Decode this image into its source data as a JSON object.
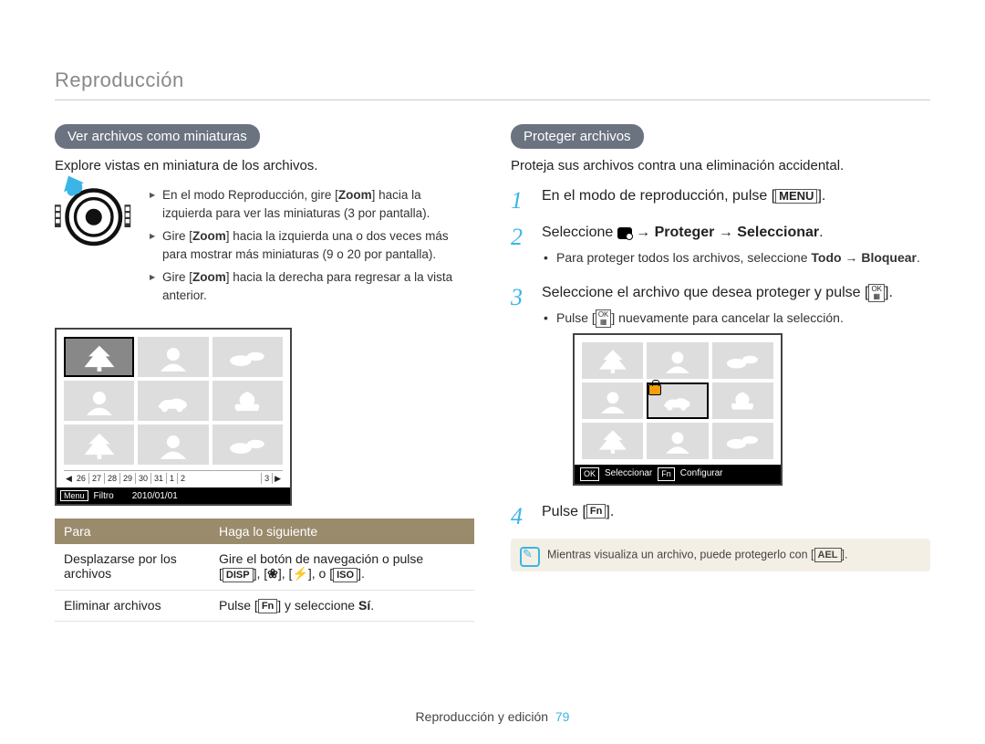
{
  "header": {
    "title": "Reproducción"
  },
  "left": {
    "pill": "Ver archivos como miniaturas",
    "intro": "Explore vistas en miniatura de los archivos.",
    "zoom_b1a": "En el modo Reproducción, gire [",
    "zoom_b1k": "Zoom",
    "zoom_b1b": "] hacia la izquierda para ver las miniaturas (3 por pantalla).",
    "zoom_b2a": "Gire [",
    "zoom_b2k": "Zoom",
    "zoom_b2b": "] hacia la izquierda una o dos veces más para mostrar más miniaturas (9 o 20 por pantalla).",
    "zoom_b3a": "Gire [",
    "zoom_b3k": "Zoom",
    "zoom_b3b": "] hacia la derecha para regresar a la vista anterior.",
    "film": {
      "a": "26",
      "b": "27",
      "c": "28",
      "d": "29",
      "e": "30",
      "f": "31",
      "g": "1",
      "h": "2",
      "i": "3"
    },
    "status_menu": "Menu",
    "status_label": "Filtro",
    "status_date": "2010/01/01",
    "th_para": "Para",
    "th_do": "Haga lo siguiente",
    "r1c1": "Desplazarse por los archivos",
    "r1c2a": "Gire el botón de navegación o pulse",
    "r1c2_k1": "DISP",
    "r1c2_sep": ", [",
    "r1c2_flower": "❀",
    "r1c2_mid": "], [",
    "r1c2_bolt": "⚡",
    "r1c2_mid2": "], o [",
    "r1c2_k4": "ISO",
    "r1c2_end": "].",
    "r2c1": "Eliminar archivos",
    "r2c2a": "Pulse [",
    "r2c2_k": "Fn",
    "r2c2b": "] y seleccione ",
    "r2c2_si": "Sí",
    "r2c2c": "."
  },
  "right": {
    "pill": "Proteger archivos",
    "intro": "Proteja sus archivos contra una eliminación accidental.",
    "s1a": "En el modo de reproducción, pulse [",
    "s1k": "MENU",
    "s1b": "].",
    "s2a": "Seleccione ",
    "s2b": " → ",
    "s2c": "Proteger",
    "s2d": " → ",
    "s2e": "Seleccionar",
    "s2f": ".",
    "s2s1a": "Para proteger todos los archivos, seleccione ",
    "s2s1b": "Todo",
    "s2s1c": " → ",
    "s2s1d": "Bloquear",
    "s2s1e": ".",
    "s3a": "Seleccione el archivo que desea proteger y pulse [",
    "s3ok1": "OK",
    "s3b": "].",
    "s3s1a": "Pulse [",
    "s3s1ok": "OK",
    "s3s1b": "] nuevamente para cancelar la selección.",
    "status_ok": "OK",
    "status_sel": "Seleccionar",
    "status_fn": "Fn",
    "status_cfg": "Configurar",
    "s4a": "Pulse [",
    "s4k": "Fn",
    "s4b": "].",
    "note_a": "Mientras visualiza un archivo, puede protegerlo con [",
    "note_k": "AEL",
    "note_b": "]."
  },
  "footer": {
    "text": "Reproducción y edición",
    "page": "79"
  }
}
